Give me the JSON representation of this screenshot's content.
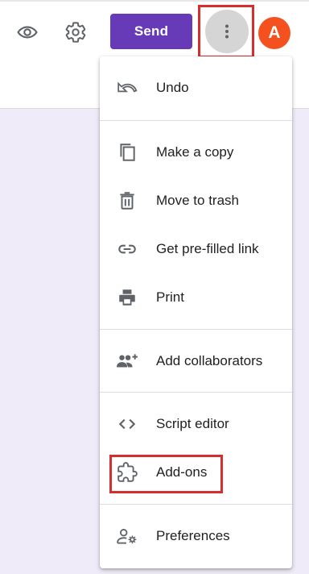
{
  "toolbar": {
    "preview_icon": "eye-icon",
    "settings_icon": "gear-icon",
    "send_label": "Send",
    "more_icon": "more-vert-icon",
    "avatar_letter": "A"
  },
  "menu": {
    "items": [
      {
        "label": "Undo",
        "icon": "undo-icon"
      },
      {
        "label": "Make a copy",
        "icon": "copy-icon"
      },
      {
        "label": "Move to trash",
        "icon": "trash-icon"
      },
      {
        "label": "Get pre-filled link",
        "icon": "link-icon"
      },
      {
        "label": "Print",
        "icon": "print-icon"
      },
      {
        "label": "Add collaborators",
        "icon": "add-people-icon"
      },
      {
        "label": "Script editor",
        "icon": "code-icon"
      },
      {
        "label": "Add-ons",
        "icon": "puzzle-icon"
      },
      {
        "label": "Preferences",
        "icon": "person-settings-icon"
      }
    ]
  },
  "colors": {
    "accent": "#673ab7",
    "avatar": "#f4511e",
    "highlight": "#d32f2f",
    "canvas": "#f0ebf8"
  }
}
